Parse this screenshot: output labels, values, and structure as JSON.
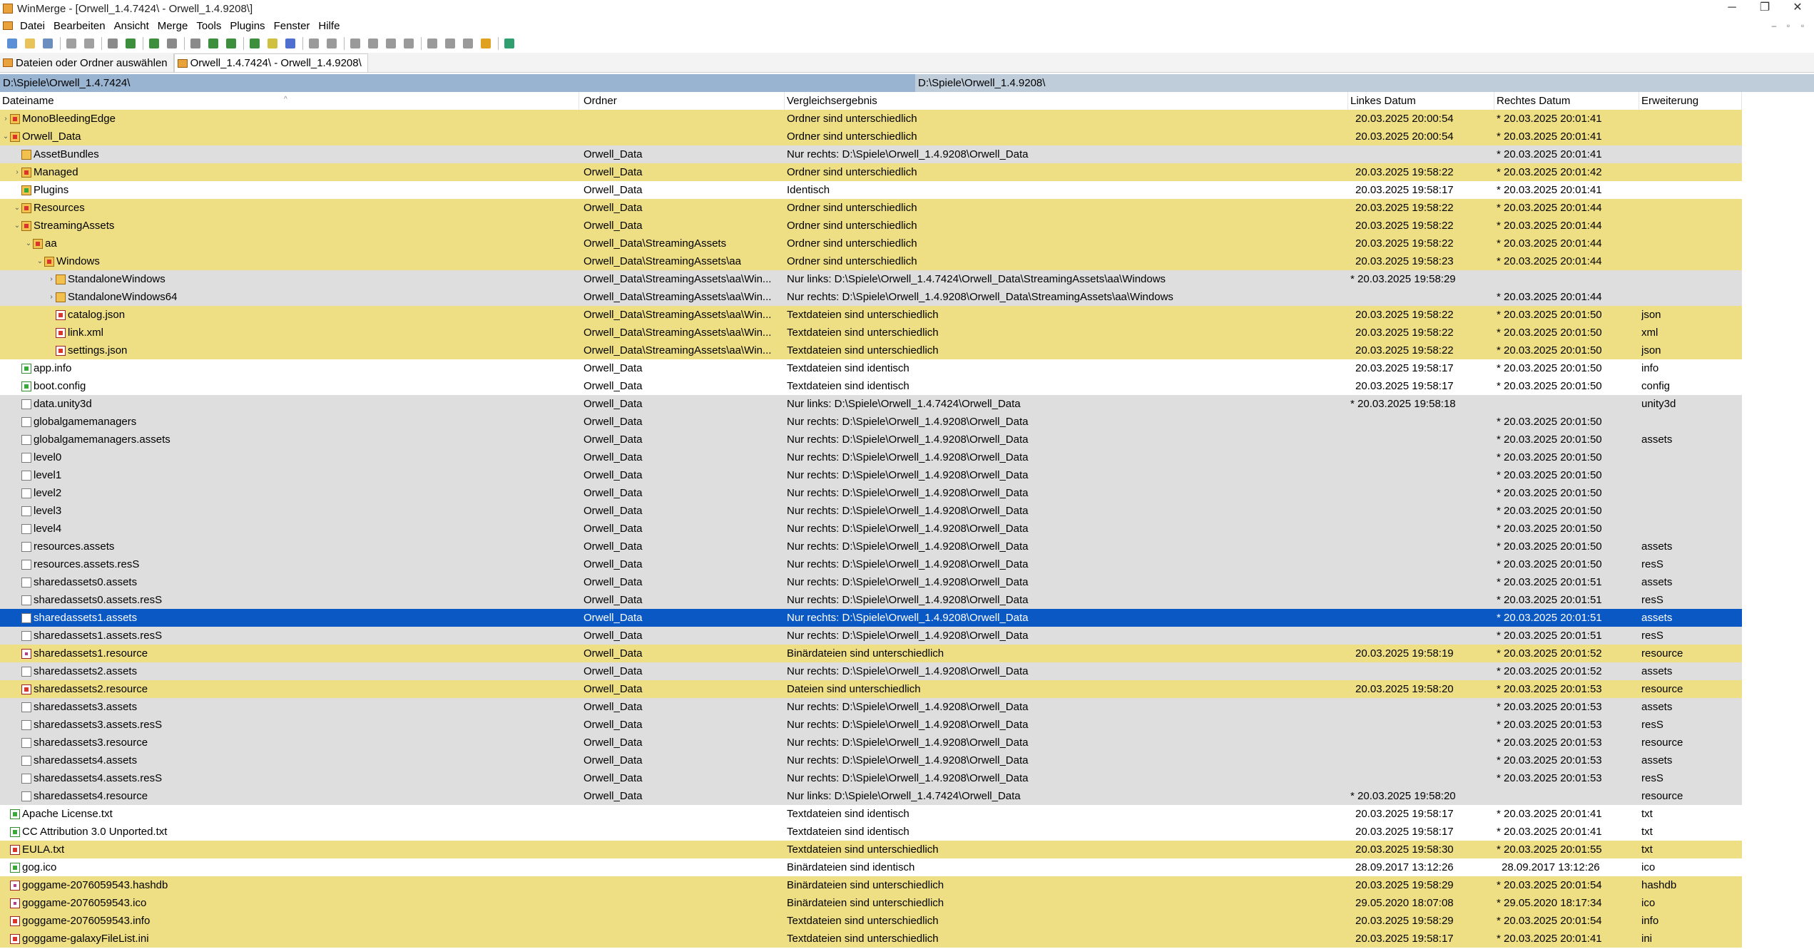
{
  "window": {
    "title": "WinMerge - [Orwell_1.4.7424\\ - Orwell_1.4.9208\\]",
    "minimize": "─",
    "restore": "❐",
    "close": "✕"
  },
  "menu": [
    "Datei",
    "Bearbeiten",
    "Ansicht",
    "Merge",
    "Tools",
    "Plugins",
    "Fenster",
    "Hilfe"
  ],
  "mdi_buttons": [
    "–",
    "▫",
    "▫"
  ],
  "toolbar": {
    "colors": [
      "#5b8fd6",
      "#e9c25a",
      "#6c8ebf",
      "#a0a0a0",
      "#a0a0a0",
      "#8a8a8a",
      "#3d8f3d",
      "#3d8f3d",
      "#8a8a8a",
      "#8a8a8a",
      "#3d8f3d",
      "#3d8f3d",
      "#3d8f3d",
      "#d0c040",
      "#5070d0",
      "#9a9a9a",
      "#9a9a9a",
      "#9a9a9a",
      "#9a9a9a",
      "#9a9a9a",
      "#9a9a9a",
      "#9a9a9a",
      "#9a9a9a",
      "#9a9a9a",
      "#e0a020",
      "#2f9f6f"
    ]
  },
  "tabs": [
    {
      "label": "Dateien oder Ordner auswählen"
    },
    {
      "label": "Orwell_1.4.7424\\ - Orwell_1.4.9208\\"
    }
  ],
  "paths": {
    "left": "D:\\Spiele\\Orwell_1.4.7424\\",
    "right": "D:\\Spiele\\Orwell_1.4.9208\\"
  },
  "columns": {
    "name": "Dateiname",
    "folder": "Ordner",
    "result": "Vergleichsergebnis",
    "left_date": "Linkes Datum",
    "right_date": "Rechtes Datum",
    "ext": "Erweiterung"
  },
  "rows": [
    {
      "state": "diff",
      "level": 0,
      "expand": "›",
      "icon": "folderdiff",
      "name": "MonoBleedingEdge",
      "folder": "",
      "result": "Ordner sind unterschiedlich",
      "ldate": "20.03.2025 20:00:54",
      "rdate": "* 20.03.2025 20:01:41",
      "ext": ""
    },
    {
      "state": "diff",
      "level": 0,
      "expand": "⌄",
      "icon": "folderdiff",
      "name": "Orwell_Data",
      "folder": "",
      "result": "Ordner sind unterschiedlich",
      "ldate": "20.03.2025 20:00:54",
      "rdate": "* 20.03.2025 20:01:41",
      "ext": ""
    },
    {
      "state": "unique",
      "level": 1,
      "expand": "",
      "icon": "folder",
      "name": "AssetBundles",
      "folder": "Orwell_Data",
      "result": "Nur rechts: D:\\Spiele\\Orwell_1.4.9208\\Orwell_Data",
      "ldate": "",
      "rdate": "* 20.03.2025 20:01:41",
      "ext": ""
    },
    {
      "state": "diff",
      "level": 1,
      "expand": "›",
      "icon": "folderdiff",
      "name": "Managed",
      "folder": "Orwell_Data",
      "result": "Ordner sind unterschiedlich",
      "ldate": "20.03.2025 19:58:22",
      "rdate": "* 20.03.2025 20:01:42",
      "ext": ""
    },
    {
      "state": "same",
      "level": 1,
      "expand": "",
      "icon": "foldersame",
      "name": "Plugins",
      "folder": "Orwell_Data",
      "result": "Identisch",
      "ldate": "20.03.2025 19:58:17",
      "rdate": "* 20.03.2025 20:01:41",
      "ext": ""
    },
    {
      "state": "diff",
      "level": 1,
      "expand": "⌄",
      "icon": "folderdiff",
      "name": "Resources",
      "folder": "Orwell_Data",
      "result": "Ordner sind unterschiedlich",
      "ldate": "20.03.2025 19:58:22",
      "rdate": "* 20.03.2025 20:01:44",
      "ext": ""
    },
    {
      "state": "diff",
      "level": 1,
      "expand": "⌄",
      "icon": "folderdiff",
      "name": "StreamingAssets",
      "folder": "Orwell_Data",
      "result": "Ordner sind unterschiedlich",
      "ldate": "20.03.2025 19:58:22",
      "rdate": "* 20.03.2025 20:01:44",
      "ext": ""
    },
    {
      "state": "diff",
      "level": 2,
      "expand": "⌄",
      "icon": "folderdiff",
      "name": "aa",
      "folder": "Orwell_Data\\StreamingAssets",
      "result": "Ordner sind unterschiedlich",
      "ldate": "20.03.2025 19:58:22",
      "rdate": "* 20.03.2025 20:01:44",
      "ext": ""
    },
    {
      "state": "diff",
      "level": 3,
      "expand": "⌄",
      "icon": "folderdiff",
      "name": "Windows",
      "folder": "Orwell_Data\\StreamingAssets\\aa",
      "result": "Ordner sind unterschiedlich",
      "ldate": "20.03.2025 19:58:23",
      "rdate": "* 20.03.2025 20:01:44",
      "ext": ""
    },
    {
      "state": "unique",
      "level": 4,
      "expand": "›",
      "icon": "folder",
      "name": "StandaloneWindows",
      "folder": "Orwell_Data\\StreamingAssets\\aa\\Win...",
      "result": "Nur links: D:\\Spiele\\Orwell_1.4.7424\\Orwell_Data\\StreamingAssets\\aa\\Windows",
      "ldate": "* 20.03.2025 19:58:29",
      "rdate": "",
      "ext": ""
    },
    {
      "state": "unique",
      "level": 4,
      "expand": "›",
      "icon": "folder",
      "name": "StandaloneWindows64",
      "folder": "Orwell_Data\\StreamingAssets\\aa\\Win...",
      "result": "Nur rechts: D:\\Spiele\\Orwell_1.4.9208\\Orwell_Data\\StreamingAssets\\aa\\Windows",
      "ldate": "",
      "rdate": "* 20.03.2025 20:01:44",
      "ext": ""
    },
    {
      "state": "diff",
      "level": 4,
      "expand": "",
      "icon": "filediff",
      "name": "catalog.json",
      "folder": "Orwell_Data\\StreamingAssets\\aa\\Win...",
      "result": "Textdateien sind unterschiedlich",
      "ldate": "20.03.2025 19:58:22",
      "rdate": "* 20.03.2025 20:01:50",
      "ext": "json"
    },
    {
      "state": "diff",
      "level": 4,
      "expand": "",
      "icon": "filediff",
      "name": "link.xml",
      "folder": "Orwell_Data\\StreamingAssets\\aa\\Win...",
      "result": "Textdateien sind unterschiedlich",
      "ldate": "20.03.2025 19:58:22",
      "rdate": "* 20.03.2025 20:01:50",
      "ext": "xml"
    },
    {
      "state": "diff",
      "level": 4,
      "expand": "",
      "icon": "filediff",
      "name": "settings.json",
      "folder": "Orwell_Data\\StreamingAssets\\aa\\Win...",
      "result": "Textdateien sind unterschiedlich",
      "ldate": "20.03.2025 19:58:22",
      "rdate": "* 20.03.2025 20:01:50",
      "ext": "json"
    },
    {
      "state": "same",
      "level": 1,
      "expand": "",
      "icon": "filesame",
      "name": "app.info",
      "folder": "Orwell_Data",
      "result": "Textdateien sind identisch",
      "ldate": "20.03.2025 19:58:17",
      "rdate": "* 20.03.2025 20:01:50",
      "ext": "info"
    },
    {
      "state": "same",
      "level": 1,
      "expand": "",
      "icon": "filesame",
      "name": "boot.config",
      "folder": "Orwell_Data",
      "result": "Textdateien sind identisch",
      "ldate": "20.03.2025 19:58:17",
      "rdate": "* 20.03.2025 20:01:50",
      "ext": "config"
    },
    {
      "state": "unique",
      "level": 1,
      "expand": "",
      "icon": "file",
      "name": "data.unity3d",
      "folder": "Orwell_Data",
      "result": "Nur links: D:\\Spiele\\Orwell_1.4.7424\\Orwell_Data",
      "ldate": "* 20.03.2025 19:58:18",
      "rdate": "",
      "ext": "unity3d"
    },
    {
      "state": "unique",
      "level": 1,
      "expand": "",
      "icon": "file",
      "name": "globalgamemanagers",
      "folder": "Orwell_Data",
      "result": "Nur rechts: D:\\Spiele\\Orwell_1.4.9208\\Orwell_Data",
      "ldate": "",
      "rdate": "* 20.03.2025 20:01:50",
      "ext": ""
    },
    {
      "state": "unique",
      "level": 1,
      "expand": "",
      "icon": "file",
      "name": "globalgamemanagers.assets",
      "folder": "Orwell_Data",
      "result": "Nur rechts: D:\\Spiele\\Orwell_1.4.9208\\Orwell_Data",
      "ldate": "",
      "rdate": "* 20.03.2025 20:01:50",
      "ext": "assets"
    },
    {
      "state": "unique",
      "level": 1,
      "expand": "",
      "icon": "file",
      "name": "level0",
      "folder": "Orwell_Data",
      "result": "Nur rechts: D:\\Spiele\\Orwell_1.4.9208\\Orwell_Data",
      "ldate": "",
      "rdate": "* 20.03.2025 20:01:50",
      "ext": ""
    },
    {
      "state": "unique",
      "level": 1,
      "expand": "",
      "icon": "file",
      "name": "level1",
      "folder": "Orwell_Data",
      "result": "Nur rechts: D:\\Spiele\\Orwell_1.4.9208\\Orwell_Data",
      "ldate": "",
      "rdate": "* 20.03.2025 20:01:50",
      "ext": ""
    },
    {
      "state": "unique",
      "level": 1,
      "expand": "",
      "icon": "file",
      "name": "level2",
      "folder": "Orwell_Data",
      "result": "Nur rechts: D:\\Spiele\\Orwell_1.4.9208\\Orwell_Data",
      "ldate": "",
      "rdate": "* 20.03.2025 20:01:50",
      "ext": ""
    },
    {
      "state": "unique",
      "level": 1,
      "expand": "",
      "icon": "file",
      "name": "level3",
      "folder": "Orwell_Data",
      "result": "Nur rechts: D:\\Spiele\\Orwell_1.4.9208\\Orwell_Data",
      "ldate": "",
      "rdate": "* 20.03.2025 20:01:50",
      "ext": ""
    },
    {
      "state": "unique",
      "level": 1,
      "expand": "",
      "icon": "file",
      "name": "level4",
      "folder": "Orwell_Data",
      "result": "Nur rechts: D:\\Spiele\\Orwell_1.4.9208\\Orwell_Data",
      "ldate": "",
      "rdate": "* 20.03.2025 20:01:50",
      "ext": ""
    },
    {
      "state": "unique",
      "level": 1,
      "expand": "",
      "icon": "file",
      "name": "resources.assets",
      "folder": "Orwell_Data",
      "result": "Nur rechts: D:\\Spiele\\Orwell_1.4.9208\\Orwell_Data",
      "ldate": "",
      "rdate": "* 20.03.2025 20:01:50",
      "ext": "assets"
    },
    {
      "state": "unique",
      "level": 1,
      "expand": "",
      "icon": "file",
      "name": "resources.assets.resS",
      "folder": "Orwell_Data",
      "result": "Nur rechts: D:\\Spiele\\Orwell_1.4.9208\\Orwell_Data",
      "ldate": "",
      "rdate": "* 20.03.2025 20:01:50",
      "ext": "resS"
    },
    {
      "state": "unique",
      "level": 1,
      "expand": "",
      "icon": "file",
      "name": "sharedassets0.assets",
      "folder": "Orwell_Data",
      "result": "Nur rechts: D:\\Spiele\\Orwell_1.4.9208\\Orwell_Data",
      "ldate": "",
      "rdate": "* 20.03.2025 20:01:51",
      "ext": "assets"
    },
    {
      "state": "unique",
      "level": 1,
      "expand": "",
      "icon": "file",
      "name": "sharedassets0.assets.resS",
      "folder": "Orwell_Data",
      "result": "Nur rechts: D:\\Spiele\\Orwell_1.4.9208\\Orwell_Data",
      "ldate": "",
      "rdate": "* 20.03.2025 20:01:51",
      "ext": "resS"
    },
    {
      "state": "selected",
      "level": 1,
      "expand": "",
      "icon": "file",
      "name": "sharedassets1.assets",
      "folder": "Orwell_Data",
      "result": "Nur rechts: D:\\Spiele\\Orwell_1.4.9208\\Orwell_Data",
      "ldate": "",
      "rdate": "* 20.03.2025 20:01:51",
      "ext": "assets"
    },
    {
      "state": "unique",
      "level": 1,
      "expand": "",
      "icon": "file",
      "name": "sharedassets1.assets.resS",
      "folder": "Orwell_Data",
      "result": "Nur rechts: D:\\Spiele\\Orwell_1.4.9208\\Orwell_Data",
      "ldate": "",
      "rdate": "* 20.03.2025 20:01:51",
      "ext": "resS"
    },
    {
      "state": "diff",
      "level": 1,
      "expand": "",
      "icon": "bin",
      "name": "sharedassets1.resource",
      "folder": "Orwell_Data",
      "result": "Binärdateien sind unterschiedlich",
      "ldate": "20.03.2025 19:58:19",
      "rdate": "* 20.03.2025 20:01:52",
      "ext": "resource"
    },
    {
      "state": "unique",
      "level": 1,
      "expand": "",
      "icon": "file",
      "name": "sharedassets2.assets",
      "folder": "Orwell_Data",
      "result": "Nur rechts: D:\\Spiele\\Orwell_1.4.9208\\Orwell_Data",
      "ldate": "",
      "rdate": "* 20.03.2025 20:01:52",
      "ext": "assets"
    },
    {
      "state": "diff",
      "level": 1,
      "expand": "",
      "icon": "filediff",
      "name": "sharedassets2.resource",
      "folder": "Orwell_Data",
      "result": "Dateien sind unterschiedlich",
      "ldate": "20.03.2025 19:58:20",
      "rdate": "* 20.03.2025 20:01:53",
      "ext": "resource"
    },
    {
      "state": "unique",
      "level": 1,
      "expand": "",
      "icon": "file",
      "name": "sharedassets3.assets",
      "folder": "Orwell_Data",
      "result": "Nur rechts: D:\\Spiele\\Orwell_1.4.9208\\Orwell_Data",
      "ldate": "",
      "rdate": "* 20.03.2025 20:01:53",
      "ext": "assets"
    },
    {
      "state": "unique",
      "level": 1,
      "expand": "",
      "icon": "file",
      "name": "sharedassets3.assets.resS",
      "folder": "Orwell_Data",
      "result": "Nur rechts: D:\\Spiele\\Orwell_1.4.9208\\Orwell_Data",
      "ldate": "",
      "rdate": "* 20.03.2025 20:01:53",
      "ext": "resS"
    },
    {
      "state": "unique",
      "level": 1,
      "expand": "",
      "icon": "file",
      "name": "sharedassets3.resource",
      "folder": "Orwell_Data",
      "result": "Nur rechts: D:\\Spiele\\Orwell_1.4.9208\\Orwell_Data",
      "ldate": "",
      "rdate": "* 20.03.2025 20:01:53",
      "ext": "resource"
    },
    {
      "state": "unique",
      "level": 1,
      "expand": "",
      "icon": "file",
      "name": "sharedassets4.assets",
      "folder": "Orwell_Data",
      "result": "Nur rechts: D:\\Spiele\\Orwell_1.4.9208\\Orwell_Data",
      "ldate": "",
      "rdate": "* 20.03.2025 20:01:53",
      "ext": "assets"
    },
    {
      "state": "unique",
      "level": 1,
      "expand": "",
      "icon": "file",
      "name": "sharedassets4.assets.resS",
      "folder": "Orwell_Data",
      "result": "Nur rechts: D:\\Spiele\\Orwell_1.4.9208\\Orwell_Data",
      "ldate": "",
      "rdate": "* 20.03.2025 20:01:53",
      "ext": "resS"
    },
    {
      "state": "unique",
      "level": 1,
      "expand": "",
      "icon": "file",
      "name": "sharedassets4.resource",
      "folder": "Orwell_Data",
      "result": "Nur links: D:\\Spiele\\Orwell_1.4.7424\\Orwell_Data",
      "ldate": "* 20.03.2025 19:58:20",
      "rdate": "",
      "ext": "resource"
    },
    {
      "state": "same",
      "level": 0,
      "expand": "",
      "icon": "filesame",
      "name": "Apache License.txt",
      "folder": "",
      "result": "Textdateien sind identisch",
      "ldate": "20.03.2025 19:58:17",
      "rdate": "* 20.03.2025 20:01:41",
      "ext": "txt"
    },
    {
      "state": "same",
      "level": 0,
      "expand": "",
      "icon": "filesame",
      "name": "CC Attribution 3.0 Unported.txt",
      "folder": "",
      "result": "Textdateien sind identisch",
      "ldate": "20.03.2025 19:58:17",
      "rdate": "* 20.03.2025 20:01:41",
      "ext": "txt"
    },
    {
      "state": "diff",
      "level": 0,
      "expand": "",
      "icon": "filediff",
      "name": "EULA.txt",
      "folder": "",
      "result": "Textdateien sind unterschiedlich",
      "ldate": "20.03.2025 19:58:30",
      "rdate": "* 20.03.2025 20:01:55",
      "ext": "txt"
    },
    {
      "state": "same",
      "level": 0,
      "expand": "",
      "icon": "filesame",
      "name": "gog.ico",
      "folder": "",
      "result": "Binärdateien sind identisch",
      "ldate": "28.09.2017 13:12:26",
      "rdate": "28.09.2017 13:12:26",
      "ext": "ico"
    },
    {
      "state": "diff",
      "level": 0,
      "expand": "",
      "icon": "bin",
      "name": "goggame-2076059543.hashdb",
      "folder": "",
      "result": "Binärdateien sind unterschiedlich",
      "ldate": "20.03.2025 19:58:29",
      "rdate": "* 20.03.2025 20:01:54",
      "ext": "hashdb"
    },
    {
      "state": "diff",
      "level": 0,
      "expand": "",
      "icon": "bin",
      "name": "goggame-2076059543.ico",
      "folder": "",
      "result": "Binärdateien sind unterschiedlich",
      "ldate": "29.05.2020 18:07:08",
      "rdate": "* 29.05.2020 18:17:34",
      "ext": "ico"
    },
    {
      "state": "diff",
      "level": 0,
      "expand": "",
      "icon": "filediff",
      "name": "goggame-2076059543.info",
      "folder": "",
      "result": "Textdateien sind unterschiedlich",
      "ldate": "20.03.2025 19:58:29",
      "rdate": "* 20.03.2025 20:01:54",
      "ext": "info"
    },
    {
      "state": "diff",
      "level": 0,
      "expand": "",
      "icon": "filediff",
      "name": "goggame-galaxyFileList.ini",
      "folder": "",
      "result": "Textdateien sind unterschiedlich",
      "ldate": "20.03.2025 19:58:17",
      "rdate": "* 20.03.2025 20:01:41",
      "ext": "ini"
    }
  ]
}
